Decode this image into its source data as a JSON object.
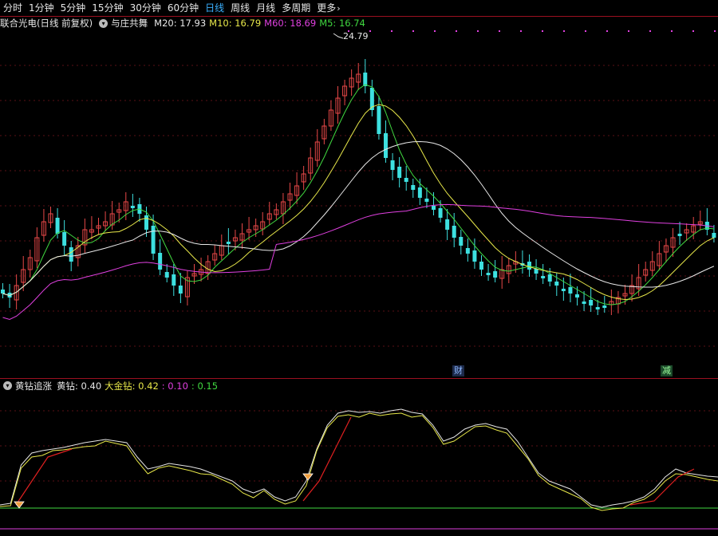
{
  "toolbar": {
    "tabs": [
      {
        "label": "分时",
        "active": false
      },
      {
        "label": "1分钟",
        "active": false
      },
      {
        "label": "5分钟",
        "active": false
      },
      {
        "label": "15分钟",
        "active": false
      },
      {
        "label": "30分钟",
        "active": false
      },
      {
        "label": "60分钟",
        "active": false
      },
      {
        "label": "日线",
        "active": true
      },
      {
        "label": "周线",
        "active": false
      },
      {
        "label": "月线",
        "active": false
      },
      {
        "label": "多周期",
        "active": false
      }
    ],
    "more_label": "更多",
    "more_icon": "chevron-right-icon"
  },
  "main": {
    "stock_name": "联合光电(日线 前复权)",
    "indicator_name": "与庄共舞",
    "ma20_label": "M20: 17.93",
    "ma10_label": "M10: 16.79",
    "ma60_label": "M60: 18.69",
    "ma5_label": "M5: 16.74",
    "high_price_label": "24.79",
    "badge_finance": "财",
    "badge_reduce": "减",
    "colors": {
      "ma20": "#e8e8e8",
      "ma10": "#e8e84a",
      "ma60": "#e040e0",
      "ma5": "#40d840",
      "up": "#e84848",
      "down": "#3de0e0",
      "grid": "#5a0f16",
      "border": "#9b1020"
    }
  },
  "sub": {
    "indicator_name": "黄钻追涨",
    "huangzuan_label": "黄钻: 0.40",
    "dajinzuan_label": "大金钻: 0.42",
    "v3_label": ": 0.10",
    "v4_label": ": 0.15",
    "colors": {
      "huangzuan": "#e6e6e6",
      "dajinzuan": "#e8e84a",
      "v3": "#e040e0",
      "v4": "#40d840",
      "rise": "#e02020"
    }
  }
}
